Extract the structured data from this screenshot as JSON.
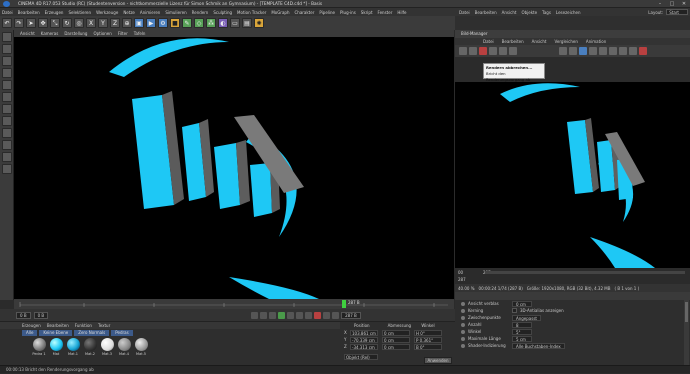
{
  "window": {
    "title": "CINEMA 4D R17.053 Studio (RC) (Studentenversion - nichtkommerzielle Lizenz für Simon Schmik an Gymnasium) - [TEMPLATE C4D.c4d *] - Basis"
  },
  "menubar": [
    "Datei",
    "Bearbeiten",
    "Erzeugen",
    "Selektieren",
    "Werkzeuge",
    "Netze",
    "Animieren",
    "Simulieren",
    "Rendern",
    "Sculpting",
    "Motion Tracker",
    "MoGraph",
    "Charakter",
    "Pipeline",
    "Plug-ins",
    "Skript",
    "Fenster",
    "Hilfe"
  ],
  "viewport": {
    "menu": [
      "Ansicht",
      "Kameras",
      "Darstellung",
      "Optionen",
      "Filter",
      "Tafeln"
    ],
    "frame_end_value": "287 B"
  },
  "timeline": {
    "start": "0 B",
    "end": "287 B",
    "marker": "287 B",
    "field": "0 B"
  },
  "materials": {
    "menu": [
      "Erzeugen",
      "Bearbeiten",
      "Funktion",
      "Textur"
    ],
    "tabs": [
      "Alle",
      "Keine Ebene",
      "Zero Normals",
      "Pedras"
    ],
    "items": [
      "Pedra 1",
      "Mat",
      "Mat.1",
      "Mat.2",
      "Mat.3",
      "Mat.4",
      "Mat.5"
    ]
  },
  "coords": {
    "headers": [
      "Position",
      "Abmessung",
      "Winkel"
    ],
    "rows": [
      {
        "axis": "X",
        "pos": "103.861 cm",
        "size": "0 cm",
        "angle": "H 0°"
      },
      {
        "axis": "Y",
        "pos": "-70.339 cm",
        "size": "0 cm",
        "angle": "P 0.361°"
      },
      {
        "axis": "Z",
        "pos": "-34.313 cm",
        "size": "0 cm",
        "angle": "B 0°"
      }
    ],
    "mode": "Objekt (Rel)",
    "apply": "Anwenden"
  },
  "status": "00:00:13  Bricht den Renderungsvorgang ab",
  "right": {
    "menu": [
      "Datei",
      "Bearbeiten",
      "Ansicht",
      "Objekte",
      "Tags",
      "Lesezeichen"
    ],
    "layout_label": "Layout:",
    "layout_value": "Start"
  },
  "bildmanager": {
    "title": "Bild-Manager",
    "menu": [
      "Datei",
      "Bearbeiten",
      "Ansicht",
      "Vergleichen",
      "Animation"
    ],
    "tooltip": [
      "Rendern abbrechen...",
      "Bricht den Renderungsvorgang ab"
    ],
    "scale": {
      "a": "00",
      "b": "287",
      "c": "287"
    },
    "info": [
      "40.00 %",
      "00:00:24 1/74 (287 B)",
      "Größe: 1920x1080, RGB (32 Bit), 4.32 MB",
      "( B 1 von 1 )"
    ],
    "props": [
      {
        "label": "Ansicht verblas",
        "value": "0 cm"
      },
      {
        "label": "Kerning",
        "value": "3D-Antialias anzeigen"
      },
      {
        "label": "Zwischenpunkte",
        "value": "Angepasst"
      },
      {
        "label": "Anzahl",
        "value": "8"
      },
      {
        "label": "Winkel",
        "value": "5°"
      },
      {
        "label": "Maximale Länge",
        "value": "5 cm"
      },
      {
        "label": "Shader-Indizierung",
        "value": "Alle Buchstaben-Index"
      }
    ]
  }
}
